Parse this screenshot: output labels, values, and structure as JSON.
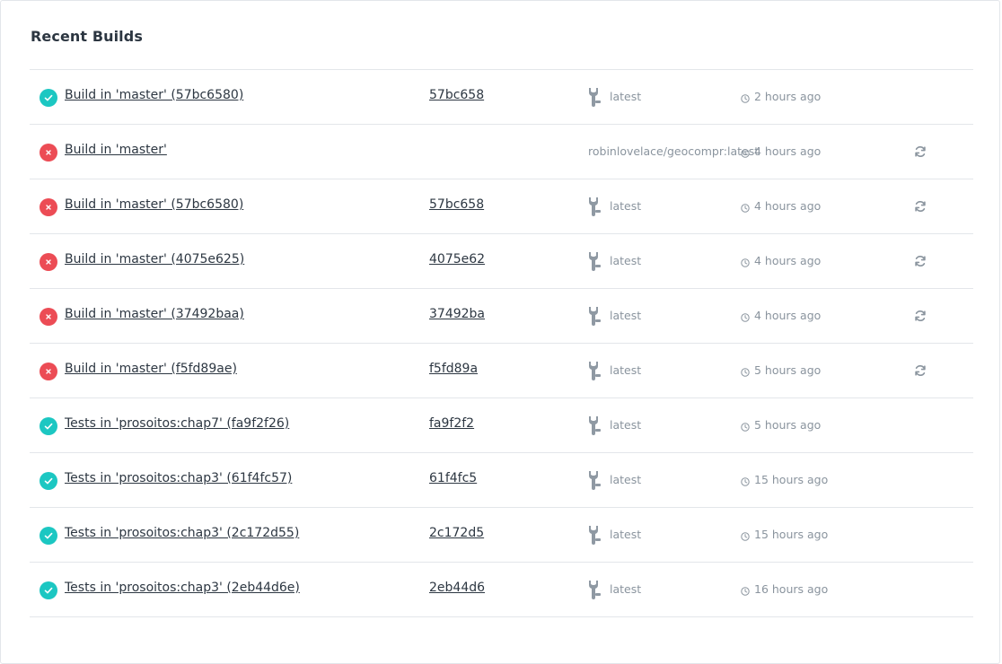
{
  "page": {
    "title": "Recent Builds"
  },
  "colors": {
    "success": "#1cc7c2",
    "failure": "#ec4c55",
    "muted": "#8a949e"
  },
  "icons": {
    "success": "check-circle-icon",
    "failure": "x-circle-icon",
    "tag": "wrench-tag-icon",
    "time": "clock-icon",
    "rebuild": "refresh-icon"
  },
  "builds": [
    {
      "status": "success",
      "name": "Build in 'master' (57bc6580)",
      "commit": "57bc658",
      "tag": "latest",
      "time": "2 hours ago",
      "rebuild": false
    },
    {
      "status": "failure",
      "name": "Build in 'master'",
      "commit": "",
      "tag": "robinlovelace/geocompr:latest",
      "time": "4 hours ago",
      "rebuild": true
    },
    {
      "status": "failure",
      "name": "Build in 'master' (57bc6580)",
      "commit": "57bc658",
      "tag": "latest",
      "time": "4 hours ago",
      "rebuild": true
    },
    {
      "status": "failure",
      "name": "Build in 'master' (4075e625)",
      "commit": "4075e62",
      "tag": "latest",
      "time": "4 hours ago",
      "rebuild": true
    },
    {
      "status": "failure",
      "name": "Build in 'master' (37492baa)",
      "commit": "37492ba",
      "tag": "latest",
      "time": "4 hours ago",
      "rebuild": true
    },
    {
      "status": "failure",
      "name": "Build in 'master' (f5fd89ae)",
      "commit": "f5fd89a",
      "tag": "latest",
      "time": "5 hours ago",
      "rebuild": true
    },
    {
      "status": "success",
      "name": "Tests in 'prosoitos:chap7' (fa9f2f26)",
      "commit": "fa9f2f2",
      "tag": "latest",
      "time": "5 hours ago",
      "rebuild": false
    },
    {
      "status": "success",
      "name": "Tests in 'prosoitos:chap3' (61f4fc57)",
      "commit": "61f4fc5",
      "tag": "latest",
      "time": "15 hours ago",
      "rebuild": false
    },
    {
      "status": "success",
      "name": "Tests in 'prosoitos:chap3' (2c172d55)",
      "commit": "2c172d5",
      "tag": "latest",
      "time": "15 hours ago",
      "rebuild": false
    },
    {
      "status": "success",
      "name": "Tests in 'prosoitos:chap3' (2eb44d6e)",
      "commit": "2eb44d6",
      "tag": "latest",
      "time": "16 hours ago",
      "rebuild": false
    }
  ]
}
